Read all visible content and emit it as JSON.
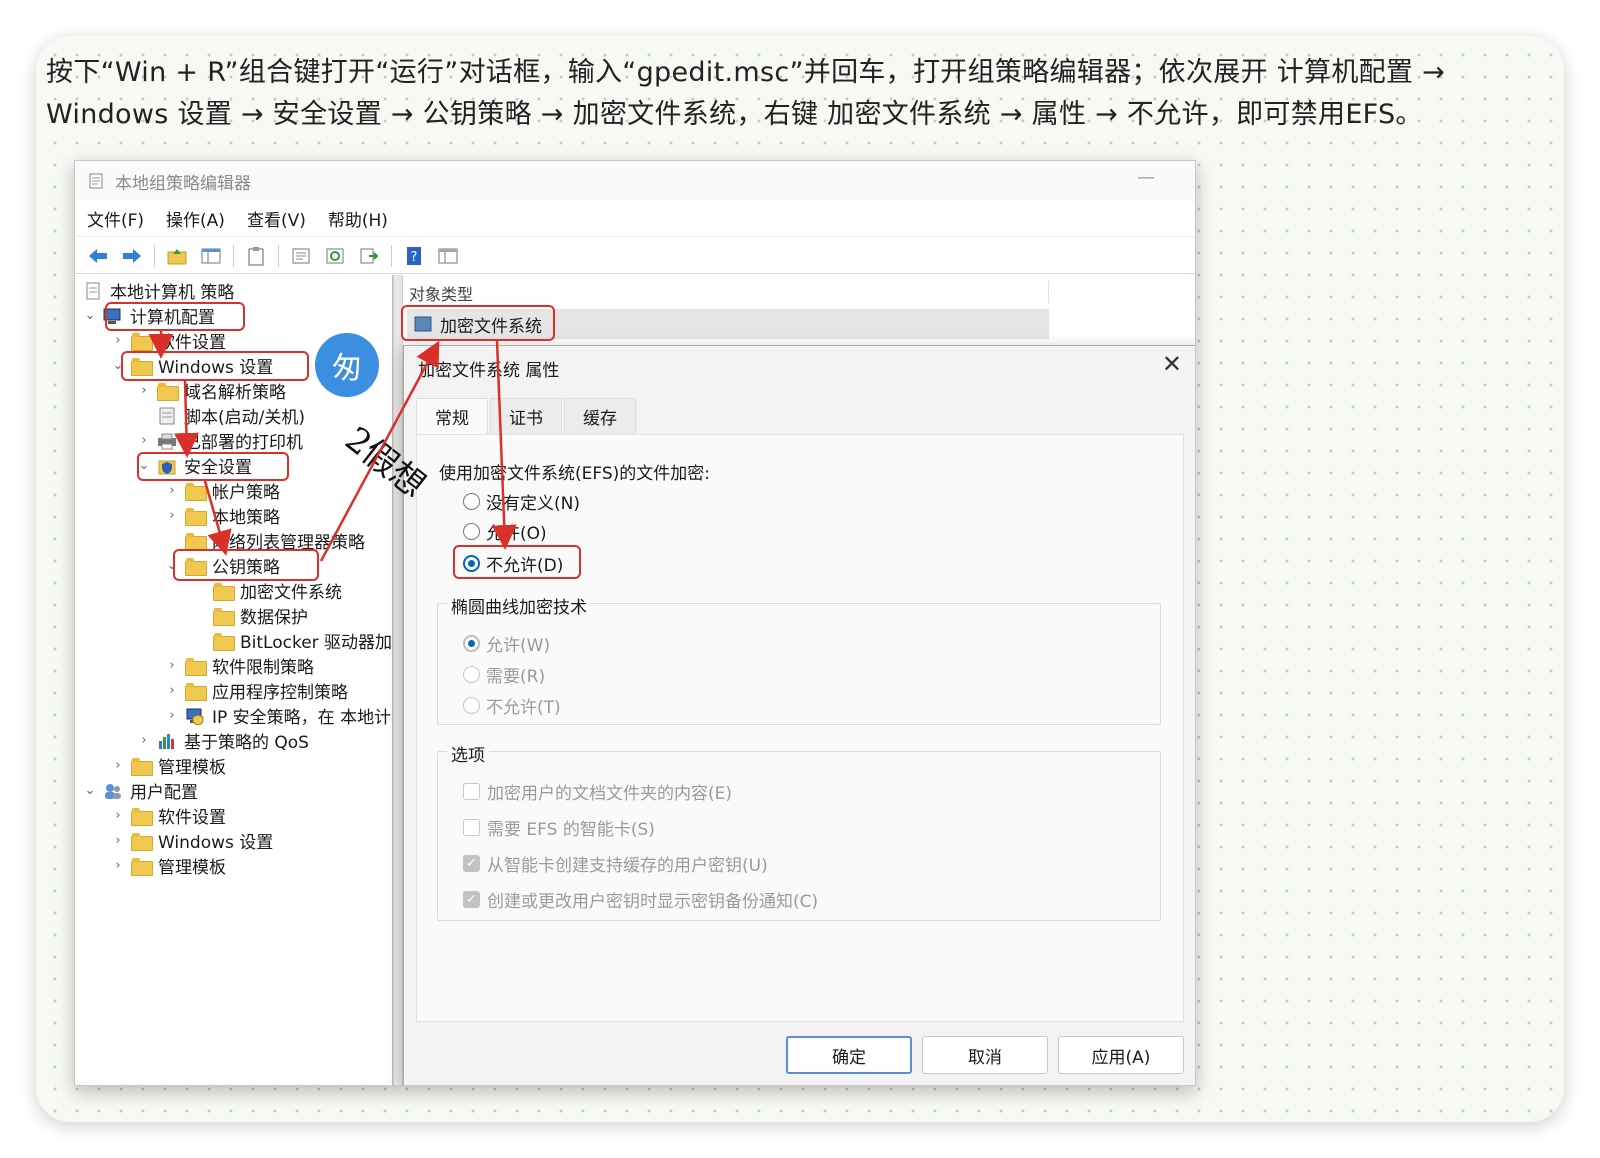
{
  "caption": "按下“Win + R”组合键打开“运行”对话框，输入“gpedit.msc”并回车，打开组策略编辑器；依次展开 计算机配置 → Windows 设置 → 安全设置 → 公钥策略 → 加密文件系统，右键 加密文件系统 → 属性 → 不允许，即可禁用EFS。",
  "window": {
    "title": "本地组策略编辑器",
    "minimize_glyph": "—",
    "menu": [
      "文件(F)",
      "操作(A)",
      "查看(V)",
      "帮助(H)"
    ]
  },
  "tree": {
    "root": "本地计算机 策略",
    "computer_config": "计算机配置",
    "software_settings": "软件设置",
    "windows_settings": "Windows 设置",
    "dns_policy": "域名解析策略",
    "scripts": "脚本(启动/关机)",
    "printers": "已部署的打印机",
    "security_settings": "安全设置",
    "account_policy": "帐户策略",
    "local_policy": "本地策略",
    "network_list": "网络列表管理器策略",
    "public_key": "公钥策略",
    "efs": "加密文件系统",
    "data_protection": "数据保护",
    "bitlocker": "BitLocker 驱动器加",
    "software_restriction": "软件限制策略",
    "app_control": "应用程序控制策略",
    "ipsec": "IP 安全策略，在 本地计",
    "qos": "基于策略的 QoS",
    "admin_templates": "管理模板",
    "user_config": "用户配置",
    "user_software": "软件设置",
    "user_windows": "Windows 设置",
    "user_admin": "管理模板"
  },
  "list": {
    "column_header": "对象类型",
    "row": "加密文件系统"
  },
  "dialog": {
    "title": "加密文件系统 属性",
    "close_glyph": "✕",
    "tabs": [
      "常规",
      "证书",
      "缓存"
    ],
    "efs_label": "使用加密文件系统(EFS)的文件加密:",
    "efs_options": [
      "没有定义(N)",
      "允许(O)",
      "不允许(D)"
    ],
    "efs_selected": "不允许(D)",
    "ecc_group": "椭圆曲线加密技术",
    "ecc_options": [
      "允许(W)",
      "需要(R)",
      "不允许(T)"
    ],
    "options_group": "选项",
    "options": [
      {
        "label": "加密用户的文档文件夹的内容(E)",
        "checked": false
      },
      {
        "label": "需要 EFS 的智能卡(S)",
        "checked": false
      },
      {
        "label": "从智能卡创建支持缓存的用户密钥(U)",
        "checked": true
      },
      {
        "label": "创建或更改用户密钥时显示密钥备份通知(C)",
        "checked": true
      }
    ],
    "buttons": {
      "ok": "确定",
      "cancel": "取消",
      "apply": "应用(A)"
    }
  },
  "watermark": {
    "badge_glyph": "匆",
    "text": "2假想"
  },
  "colors": {
    "highlight": "#d9302a",
    "accent": "#0067c0",
    "folder": "#f0c84f"
  }
}
